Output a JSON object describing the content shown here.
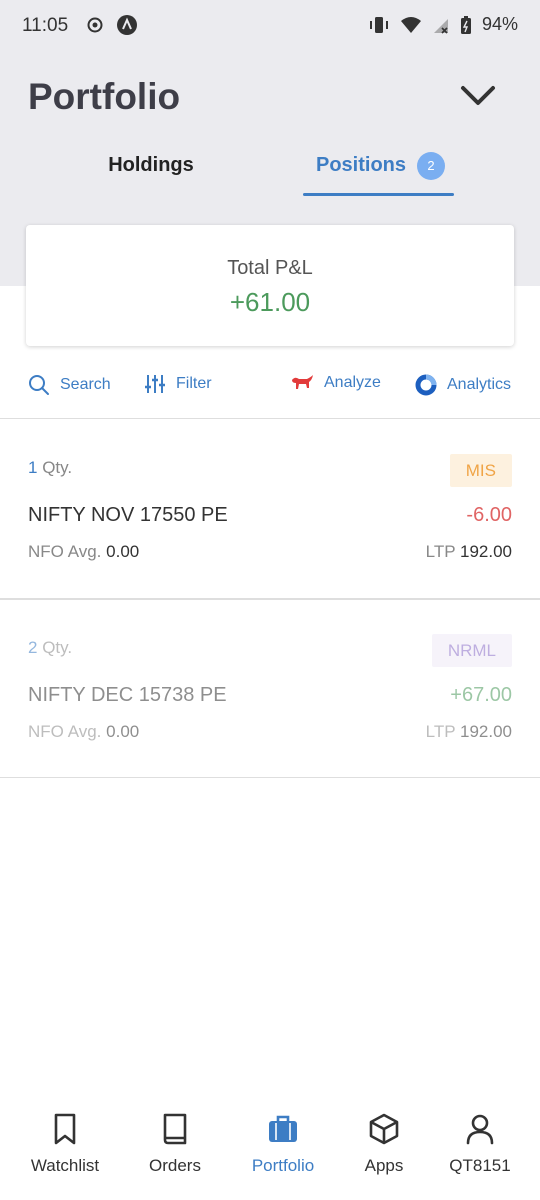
{
  "status_bar": {
    "time": "11:05",
    "battery": "94%"
  },
  "header": {
    "title": "Portfolio",
    "tabs": [
      {
        "label": "Holdings",
        "active": false
      },
      {
        "label": "Positions",
        "badge": "2",
        "active": true
      }
    ]
  },
  "pnl": {
    "label": "Total P&L",
    "value": "+61.00",
    "color": "#4c9a5c"
  },
  "toolbar": {
    "search": "Search",
    "filter": "Filter",
    "analyze": "Analyze",
    "analytics": "Analytics"
  },
  "positions": [
    {
      "qty": "1",
      "qty_label": "Qty.",
      "product": "MIS",
      "product_color": "#f0a446",
      "product_bg": "#fdf1df",
      "symbol": "NIFTY NOV 17550 PE",
      "pnl": "-6.00",
      "pnl_color": "#e06464",
      "exchange": "NFO",
      "avg_label": "Avg.",
      "avg": "0.00",
      "ltp_label": "LTP",
      "ltp": "192.00"
    },
    {
      "qty": "2",
      "qty_label": "Qty.",
      "product": "NRML",
      "product_color": "#8a6cc7",
      "product_bg": "#efeaf7",
      "symbol": "NIFTY DEC 15738 PE",
      "pnl": "+67.00",
      "pnl_color": "#4c9a5c",
      "exchange": "NFO",
      "avg_label": "Avg.",
      "avg": "0.00",
      "ltp_label": "LTP",
      "ltp": "192.00"
    }
  ],
  "bottom_nav": [
    {
      "label": "Watchlist",
      "icon": "bookmark-icon"
    },
    {
      "label": "Orders",
      "icon": "book-icon"
    },
    {
      "label": "Portfolio",
      "icon": "briefcase-icon",
      "active": true
    },
    {
      "label": "Apps",
      "icon": "cube-icon"
    },
    {
      "label": "QT8151",
      "icon": "user-icon"
    }
  ],
  "colors": {
    "accent": "#3d7dc4",
    "header_bg": "#ebebef"
  }
}
